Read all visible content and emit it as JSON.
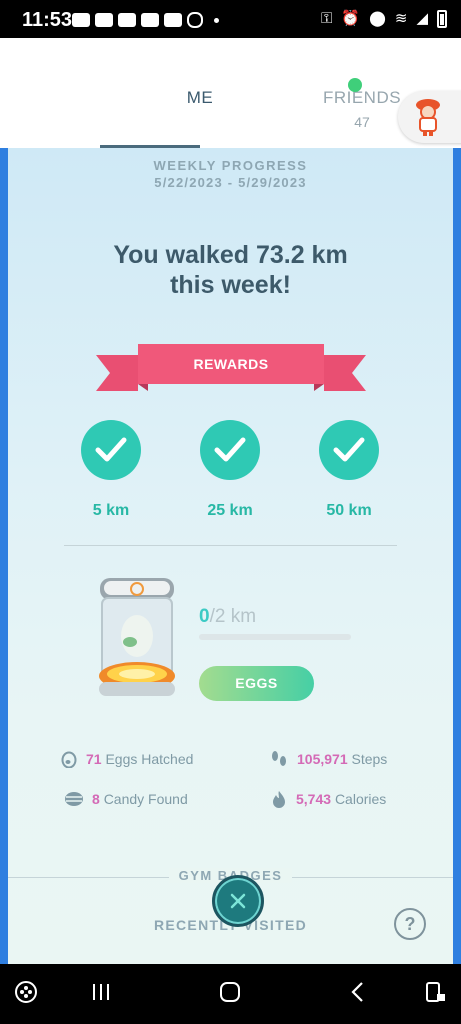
{
  "status_bar": {
    "time": "11:53"
  },
  "header": {
    "tab_me": "ME",
    "tab_friends": "FRIENDS",
    "friends_count": "47"
  },
  "weekly": {
    "title": "WEEKLY PROGRESS",
    "dates": "5/22/2023 - 5/29/2023",
    "walked_line1": "You walked 73.2 km",
    "walked_line2": "this week!"
  },
  "rewards": {
    "label": "REWARDS",
    "items": [
      {
        "distance": "5 km"
      },
      {
        "distance": "25 km"
      },
      {
        "distance": "50 km"
      }
    ]
  },
  "egg": {
    "current": "0",
    "target": "/2 km",
    "progress": 0,
    "button_label": "EGGS"
  },
  "stats": {
    "eggs_hatched_num": "71",
    "eggs_hatched_label": "Eggs Hatched",
    "steps_num": "105,971",
    "steps_label": "Steps",
    "candy_num": "8",
    "candy_label": "Candy Found",
    "calories_num": "5,743",
    "calories_label": "Calories"
  },
  "gym": {
    "title": "GYM BADGES",
    "recent": "RECENTLY VISITED",
    "help": "?"
  },
  "colors": {
    "accent_teal": "#2fc9b4",
    "ribbon": "#f0587a",
    "stat_number": "#d46ab6",
    "border_blue": "#2f7fe0"
  }
}
